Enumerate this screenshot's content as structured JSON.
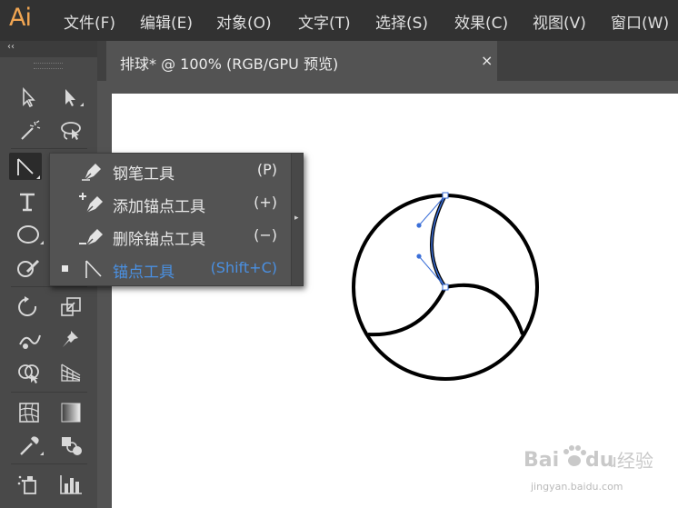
{
  "app": {
    "logo": "Ai"
  },
  "menubar": {
    "items": [
      "文件(F)",
      "编辑(E)",
      "对象(O)",
      "文字(T)",
      "选择(S)",
      "效果(C)",
      "视图(V)",
      "窗口(W)"
    ]
  },
  "toolbar": {
    "collapse_glyph": "‹‹",
    "tools": [
      "selection-tool",
      "direct-selection-tool",
      "magic-wand-tool",
      "lasso-tool",
      "pen-tool",
      "type-tool",
      "ellipse-tool",
      "shaper-tool",
      "rotate-tool",
      "scale-tool",
      "warp-tool",
      "puppet-warp-tool",
      "shape-builder-tool",
      "perspective-grid-tool",
      "mesh-tool",
      "gradient-tool",
      "eyedropper-tool",
      "blend-tool",
      "symbol-sprayer-tool",
      "column-graph-tool"
    ]
  },
  "document_tab": {
    "title": "排球* @ 100% (RGB/GPU 预览)",
    "close_glyph": "×"
  },
  "flyout": {
    "items": [
      {
        "icon": "pen-tool-icon",
        "label": "钢笔工具",
        "shortcut": "(P)",
        "active": false
      },
      {
        "icon": "add-anchor-point-icon",
        "label": "添加锚点工具",
        "shortcut": "(+)",
        "active": false
      },
      {
        "icon": "delete-anchor-point-icon",
        "label": "删除锚点工具",
        "shortcut": "(−)",
        "active": false
      },
      {
        "icon": "anchor-point-tool-icon",
        "label": "锚点工具",
        "shortcut": "(Shift+C)",
        "active": true
      }
    ],
    "expand_glyph": "▸"
  },
  "colors": {
    "menubar_bg": "#323232",
    "panel_bg": "#535353",
    "logo": "#f0a552",
    "active_item": "#4a90e2",
    "path_selection": "#3b6fd8"
  },
  "watermark": {
    "brand": "Baidu经验",
    "url": "jingyan.baidu.com"
  }
}
